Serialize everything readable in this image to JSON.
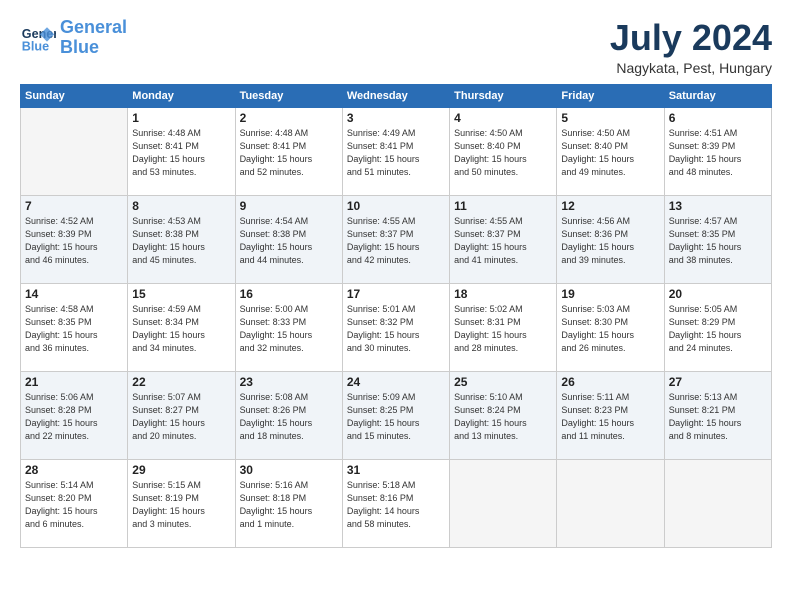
{
  "header": {
    "logo_line1": "General",
    "logo_line2": "Blue",
    "month": "July 2024",
    "location": "Nagykata, Pest, Hungary"
  },
  "weekdays": [
    "Sunday",
    "Monday",
    "Tuesday",
    "Wednesday",
    "Thursday",
    "Friday",
    "Saturday"
  ],
  "weeks": [
    [
      {
        "day": "",
        "info": ""
      },
      {
        "day": "1",
        "info": "Sunrise: 4:48 AM\nSunset: 8:41 PM\nDaylight: 15 hours\nand 53 minutes."
      },
      {
        "day": "2",
        "info": "Sunrise: 4:48 AM\nSunset: 8:41 PM\nDaylight: 15 hours\nand 52 minutes."
      },
      {
        "day": "3",
        "info": "Sunrise: 4:49 AM\nSunset: 8:41 PM\nDaylight: 15 hours\nand 51 minutes."
      },
      {
        "day": "4",
        "info": "Sunrise: 4:50 AM\nSunset: 8:40 PM\nDaylight: 15 hours\nand 50 minutes."
      },
      {
        "day": "5",
        "info": "Sunrise: 4:50 AM\nSunset: 8:40 PM\nDaylight: 15 hours\nand 49 minutes."
      },
      {
        "day": "6",
        "info": "Sunrise: 4:51 AM\nSunset: 8:39 PM\nDaylight: 15 hours\nand 48 minutes."
      }
    ],
    [
      {
        "day": "7",
        "info": "Sunrise: 4:52 AM\nSunset: 8:39 PM\nDaylight: 15 hours\nand 46 minutes."
      },
      {
        "day": "8",
        "info": "Sunrise: 4:53 AM\nSunset: 8:38 PM\nDaylight: 15 hours\nand 45 minutes."
      },
      {
        "day": "9",
        "info": "Sunrise: 4:54 AM\nSunset: 8:38 PM\nDaylight: 15 hours\nand 44 minutes."
      },
      {
        "day": "10",
        "info": "Sunrise: 4:55 AM\nSunset: 8:37 PM\nDaylight: 15 hours\nand 42 minutes."
      },
      {
        "day": "11",
        "info": "Sunrise: 4:55 AM\nSunset: 8:37 PM\nDaylight: 15 hours\nand 41 minutes."
      },
      {
        "day": "12",
        "info": "Sunrise: 4:56 AM\nSunset: 8:36 PM\nDaylight: 15 hours\nand 39 minutes."
      },
      {
        "day": "13",
        "info": "Sunrise: 4:57 AM\nSunset: 8:35 PM\nDaylight: 15 hours\nand 38 minutes."
      }
    ],
    [
      {
        "day": "14",
        "info": "Sunrise: 4:58 AM\nSunset: 8:35 PM\nDaylight: 15 hours\nand 36 minutes."
      },
      {
        "day": "15",
        "info": "Sunrise: 4:59 AM\nSunset: 8:34 PM\nDaylight: 15 hours\nand 34 minutes."
      },
      {
        "day": "16",
        "info": "Sunrise: 5:00 AM\nSunset: 8:33 PM\nDaylight: 15 hours\nand 32 minutes."
      },
      {
        "day": "17",
        "info": "Sunrise: 5:01 AM\nSunset: 8:32 PM\nDaylight: 15 hours\nand 30 minutes."
      },
      {
        "day": "18",
        "info": "Sunrise: 5:02 AM\nSunset: 8:31 PM\nDaylight: 15 hours\nand 28 minutes."
      },
      {
        "day": "19",
        "info": "Sunrise: 5:03 AM\nSunset: 8:30 PM\nDaylight: 15 hours\nand 26 minutes."
      },
      {
        "day": "20",
        "info": "Sunrise: 5:05 AM\nSunset: 8:29 PM\nDaylight: 15 hours\nand 24 minutes."
      }
    ],
    [
      {
        "day": "21",
        "info": "Sunrise: 5:06 AM\nSunset: 8:28 PM\nDaylight: 15 hours\nand 22 minutes."
      },
      {
        "day": "22",
        "info": "Sunrise: 5:07 AM\nSunset: 8:27 PM\nDaylight: 15 hours\nand 20 minutes."
      },
      {
        "day": "23",
        "info": "Sunrise: 5:08 AM\nSunset: 8:26 PM\nDaylight: 15 hours\nand 18 minutes."
      },
      {
        "day": "24",
        "info": "Sunrise: 5:09 AM\nSunset: 8:25 PM\nDaylight: 15 hours\nand 15 minutes."
      },
      {
        "day": "25",
        "info": "Sunrise: 5:10 AM\nSunset: 8:24 PM\nDaylight: 15 hours\nand 13 minutes."
      },
      {
        "day": "26",
        "info": "Sunrise: 5:11 AM\nSunset: 8:23 PM\nDaylight: 15 hours\nand 11 minutes."
      },
      {
        "day": "27",
        "info": "Sunrise: 5:13 AM\nSunset: 8:21 PM\nDaylight: 15 hours\nand 8 minutes."
      }
    ],
    [
      {
        "day": "28",
        "info": "Sunrise: 5:14 AM\nSunset: 8:20 PM\nDaylight: 15 hours\nand 6 minutes."
      },
      {
        "day": "29",
        "info": "Sunrise: 5:15 AM\nSunset: 8:19 PM\nDaylight: 15 hours\nand 3 minutes."
      },
      {
        "day": "30",
        "info": "Sunrise: 5:16 AM\nSunset: 8:18 PM\nDaylight: 15 hours\nand 1 minute."
      },
      {
        "day": "31",
        "info": "Sunrise: 5:18 AM\nSunset: 8:16 PM\nDaylight: 14 hours\nand 58 minutes."
      },
      {
        "day": "",
        "info": ""
      },
      {
        "day": "",
        "info": ""
      },
      {
        "day": "",
        "info": ""
      }
    ]
  ]
}
